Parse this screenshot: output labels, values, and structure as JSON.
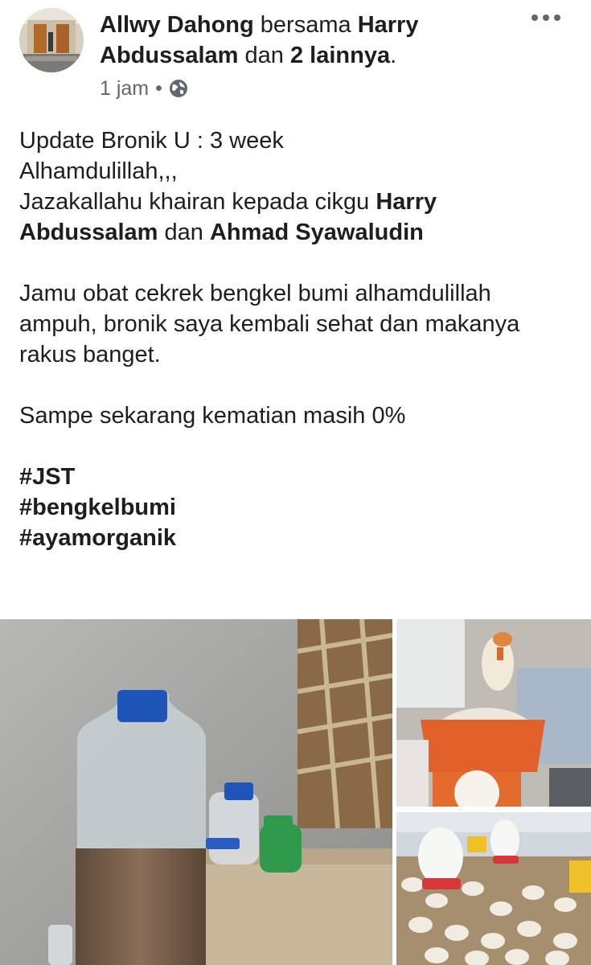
{
  "post": {
    "author": "Allwy Dahong",
    "with_word": "bersama",
    "tagged_user": "Harry Abdussalam",
    "and_word": "dan",
    "others": "2 lainnya",
    "period": ".",
    "time": "1 jam",
    "separator": "•",
    "privacy_icon": "globe-icon",
    "menu_icon": "more-options-icon"
  },
  "body": {
    "line1": "Update Bronik U : 3 week",
    "line2": "Alhamdulillah,,,",
    "line3_prefix": "Jazakallahu khairan kepada cikgu ",
    "mention1": "Harry Abdussalam",
    "line3_mid": " dan ",
    "mention2": "Ahmad Syawaludin",
    "para2": "Jamu obat cekrek bengkel bumi alhamdulillah ampuh, bronik saya kembali sehat dan makanya rakus banget.",
    "para3": "Sampe sekarang kematian masih 0%",
    "hashtags": [
      "#JST",
      "#bengkelbumi",
      "#ayamorganik"
    ]
  },
  "colors": {
    "text": "#1c1e21",
    "meta": "#606770"
  }
}
